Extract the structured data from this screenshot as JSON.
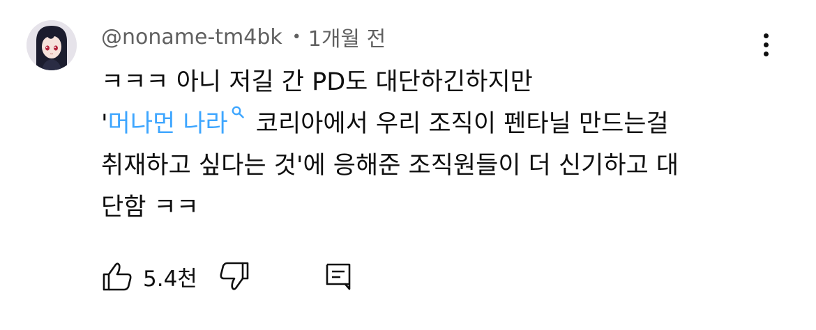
{
  "comment": {
    "author": "@noname-tm4bk",
    "separator": "•",
    "timestamp": "1개월 전",
    "lines": [
      "ㅋㅋㅋ 아니 저길 간 PD도 대단하긴하지만",
      "",
      "취재하고 싶다는 것'에 응해준 조직원들이 더 신기하고 대",
      "단함 ㅋㅋ"
    ],
    "line2_prefix": "'",
    "search_link_text": "머나먼 나라",
    "line2_suffix": "코리아에서 우리 조직이 펜타닐 만드는걸",
    "like_count": "5.4천"
  },
  "icons": {
    "avatar": "avatar-anime-girl",
    "menu": "more-vertical-icon",
    "search": "search-icon",
    "like": "thumbs-up-icon",
    "dislike": "thumbs-down-icon",
    "reply": "comment-reply-icon"
  },
  "colors": {
    "text": "#0f0f0f",
    "secondary": "#606060",
    "link": "#3ea6ff",
    "background": "#ffffff"
  }
}
